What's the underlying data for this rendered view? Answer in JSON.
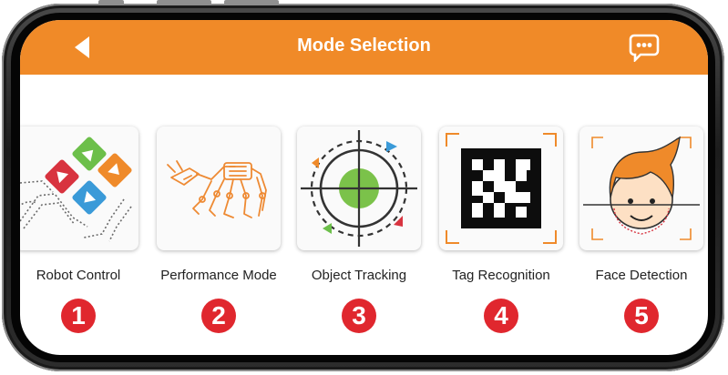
{
  "header": {
    "title": "Mode Selection",
    "back_icon": "back-arrow-icon",
    "chat_icon": "chat-bubble-icon"
  },
  "modes": [
    {
      "label": "Robot Control",
      "number": "1",
      "icon": "robot-control-icon"
    },
    {
      "label": "Performance Mode",
      "number": "2",
      "icon": "performance-mode-icon"
    },
    {
      "label": "Object Tracking",
      "number": "3",
      "icon": "object-tracking-icon"
    },
    {
      "label": "Tag Recognition",
      "number": "4",
      "icon": "tag-recognition-icon"
    },
    {
      "label": "Face Detection",
      "number": "5",
      "icon": "face-detection-icon"
    }
  ],
  "colors": {
    "header": "#f08a28",
    "badge": "#e0272e",
    "tracking_green": "#7bc24a"
  }
}
